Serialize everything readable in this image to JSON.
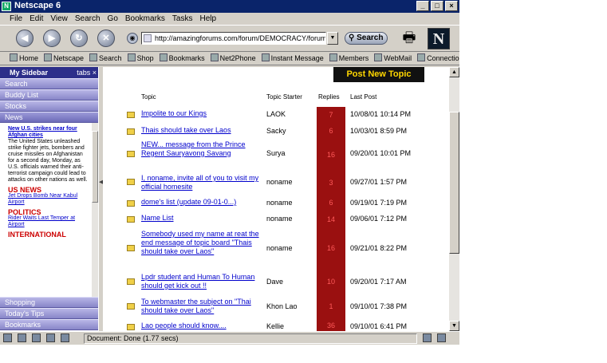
{
  "window": {
    "title": "Netscape 6"
  },
  "menu": [
    "File",
    "Edit",
    "View",
    "Search",
    "Go",
    "Bookmarks",
    "Tasks",
    "Help"
  ],
  "nav": {
    "url": "http://amazingforums.com/forum/DEMOCRACY/forum.html",
    "search_label": "Search",
    "logo": "N"
  },
  "personal_toolbar": [
    "Home",
    "Netscape",
    "Search",
    "Shop",
    "Bookmarks",
    "Net2Phone",
    "Instant Message",
    "Members",
    "WebMail",
    "Connections"
  ],
  "sidebar": {
    "title": "My Sidebar",
    "tabs_label": "tabs",
    "tabs_top": [
      "Search",
      "Buddy List",
      "Stocks",
      "News"
    ],
    "news_headline": "New U.S. strikes near four Afghan cities",
    "news_body": "The United States unleashed strike fighter jets, bombers and cruise missiles on Afghanistan for a second day, Monday, as U.S. officials warned their anti-terrorist campaign could lead to attacks on other nations as well.",
    "section1": "US NEWS",
    "section1_link": "Jet Drops Bomb Near Kabul Airport",
    "section2": "POLITICS",
    "section2_link": "Rider Waits Last Temper at Airport",
    "section3": "INTERNATIONAL",
    "tabs_bottom": [
      "Shopping",
      "Today's Tips",
      "Bookmarks"
    ]
  },
  "content": {
    "post_button": "Post New Topic",
    "headers": {
      "topic": "Topic",
      "starter": "Topic Starter",
      "replies": "Replies",
      "last": "Last Post"
    },
    "rows": [
      {
        "topic": "Impolite to our Kings",
        "starter": "LAOK",
        "replies": "7",
        "last": "10/08/01 10:14 PM"
      },
      {
        "topic": "Thais should take over Laos",
        "starter": "Sacky",
        "replies": "6",
        "last": "10/03/01 8:59 PM"
      },
      {
        "topic": "NEW... message from the Prince Regent Sauryavong Savang",
        "starter": "Surya",
        "replies": "16",
        "last": "09/20/01 10:01 PM"
      },
      {
        "topic": "I, noname, invite all of you to visit my official homesite",
        "starter": "noname",
        "replies": "3",
        "last": "09/27/01 1:57 PM"
      },
      {
        "topic": "dome's list (update 09-01-0...)",
        "starter": "noname",
        "replies": "6",
        "last": "09/19/01 7:19 PM"
      },
      {
        "topic": "Name List",
        "starter": "noname",
        "replies": "14",
        "last": "09/06/01 7:12 PM"
      },
      {
        "topic": "Somebody used my name at reat the end message of topic board \"Thais should take over Laos\"",
        "starter": "noname",
        "replies": "16",
        "last": "09/21/01 8:22 PM"
      },
      {
        "topic": "Lpdr student and Human To Human should get kick out !!",
        "starter": "Dave",
        "replies": "10",
        "last": "09/20/01 7:17 AM"
      },
      {
        "topic": "To webmaster the subject on \"Thai should take over Laos\"",
        "starter": "Khon Lao",
        "replies": "1",
        "last": "09/10/01 7:38 PM"
      },
      {
        "topic": "Lao people should know....",
        "starter": "Kellie",
        "replies": "36",
        "last": "09/10/01 6:41 PM"
      }
    ]
  },
  "status": {
    "text": "Document: Done (1.77 secs)"
  }
}
